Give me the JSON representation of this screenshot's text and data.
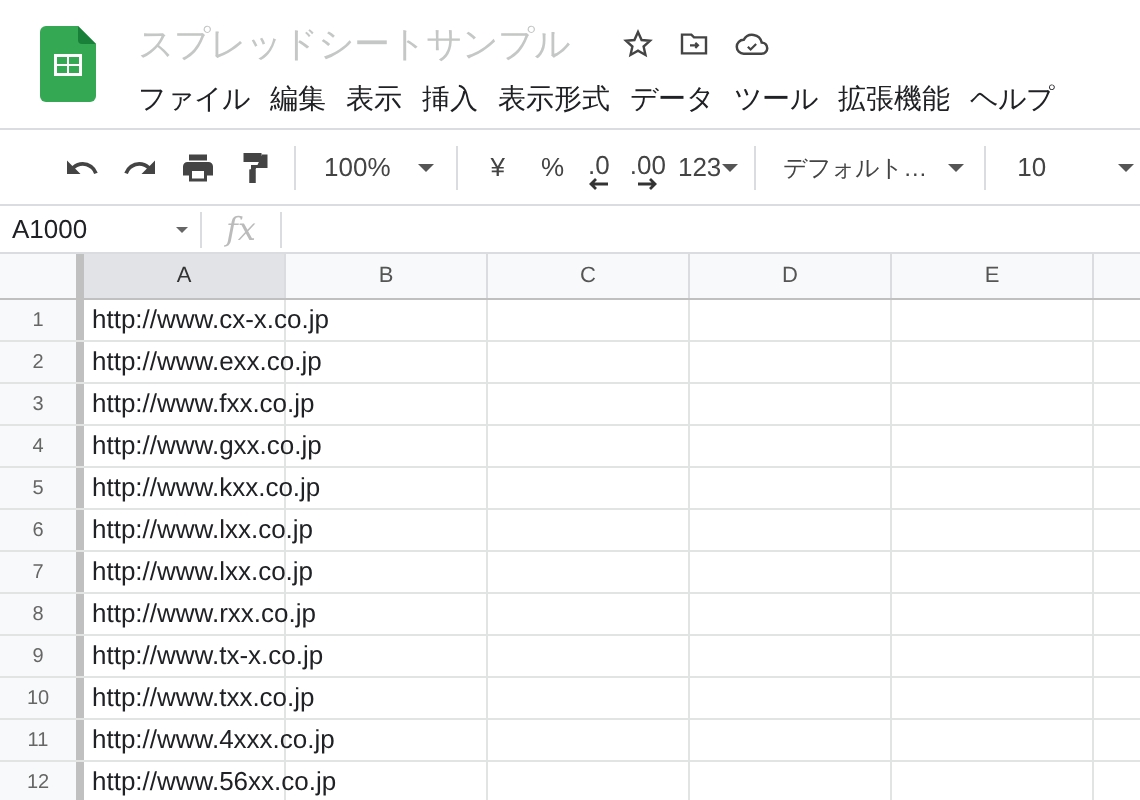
{
  "document": {
    "title": "スプレッドシートサンプル"
  },
  "menu": [
    "ファイル",
    "編集",
    "表示",
    "挿入",
    "表示形式",
    "データ",
    "ツール",
    "拡張機能",
    "ヘルプ"
  ],
  "toolbar": {
    "zoom": "100%",
    "currency": "¥",
    "percent": "%",
    "decrease_decimals": ".0",
    "increase_decimals": ".00",
    "more_formats": "123",
    "font": "デフォルト…",
    "font_size": "10"
  },
  "name_box": "A1000",
  "formula_label": "fx",
  "columns": [
    {
      "label": "A",
      "selected": true
    },
    {
      "label": "B",
      "selected": false
    },
    {
      "label": "C",
      "selected": false
    },
    {
      "label": "D",
      "selected": false
    },
    {
      "label": "E",
      "selected": false
    }
  ],
  "rows": [
    {
      "number": "1",
      "value": "http://www.cx-x.co.jp"
    },
    {
      "number": "2",
      "value": "http://www.exx.co.jp"
    },
    {
      "number": "3",
      "value": "http://www.fxx.co.jp"
    },
    {
      "number": "4",
      "value": "http://www.gxx.co.jp"
    },
    {
      "number": "5",
      "value": "http://www.kxx.co.jp"
    },
    {
      "number": "6",
      "value": "http://www.lxx.co.jp"
    },
    {
      "number": "7",
      "value": "http://www.lxx.co.jp"
    },
    {
      "number": "8",
      "value": "http://www.rxx.co.jp"
    },
    {
      "number": "9",
      "value": "http://www.tx-x.co.jp"
    },
    {
      "number": "10",
      "value": "http://www.txx.co.jp"
    },
    {
      "number": "11",
      "value": "http://www.4xxx.co.jp"
    },
    {
      "number": "12",
      "value": "http://www.56xx.co.jp"
    }
  ]
}
